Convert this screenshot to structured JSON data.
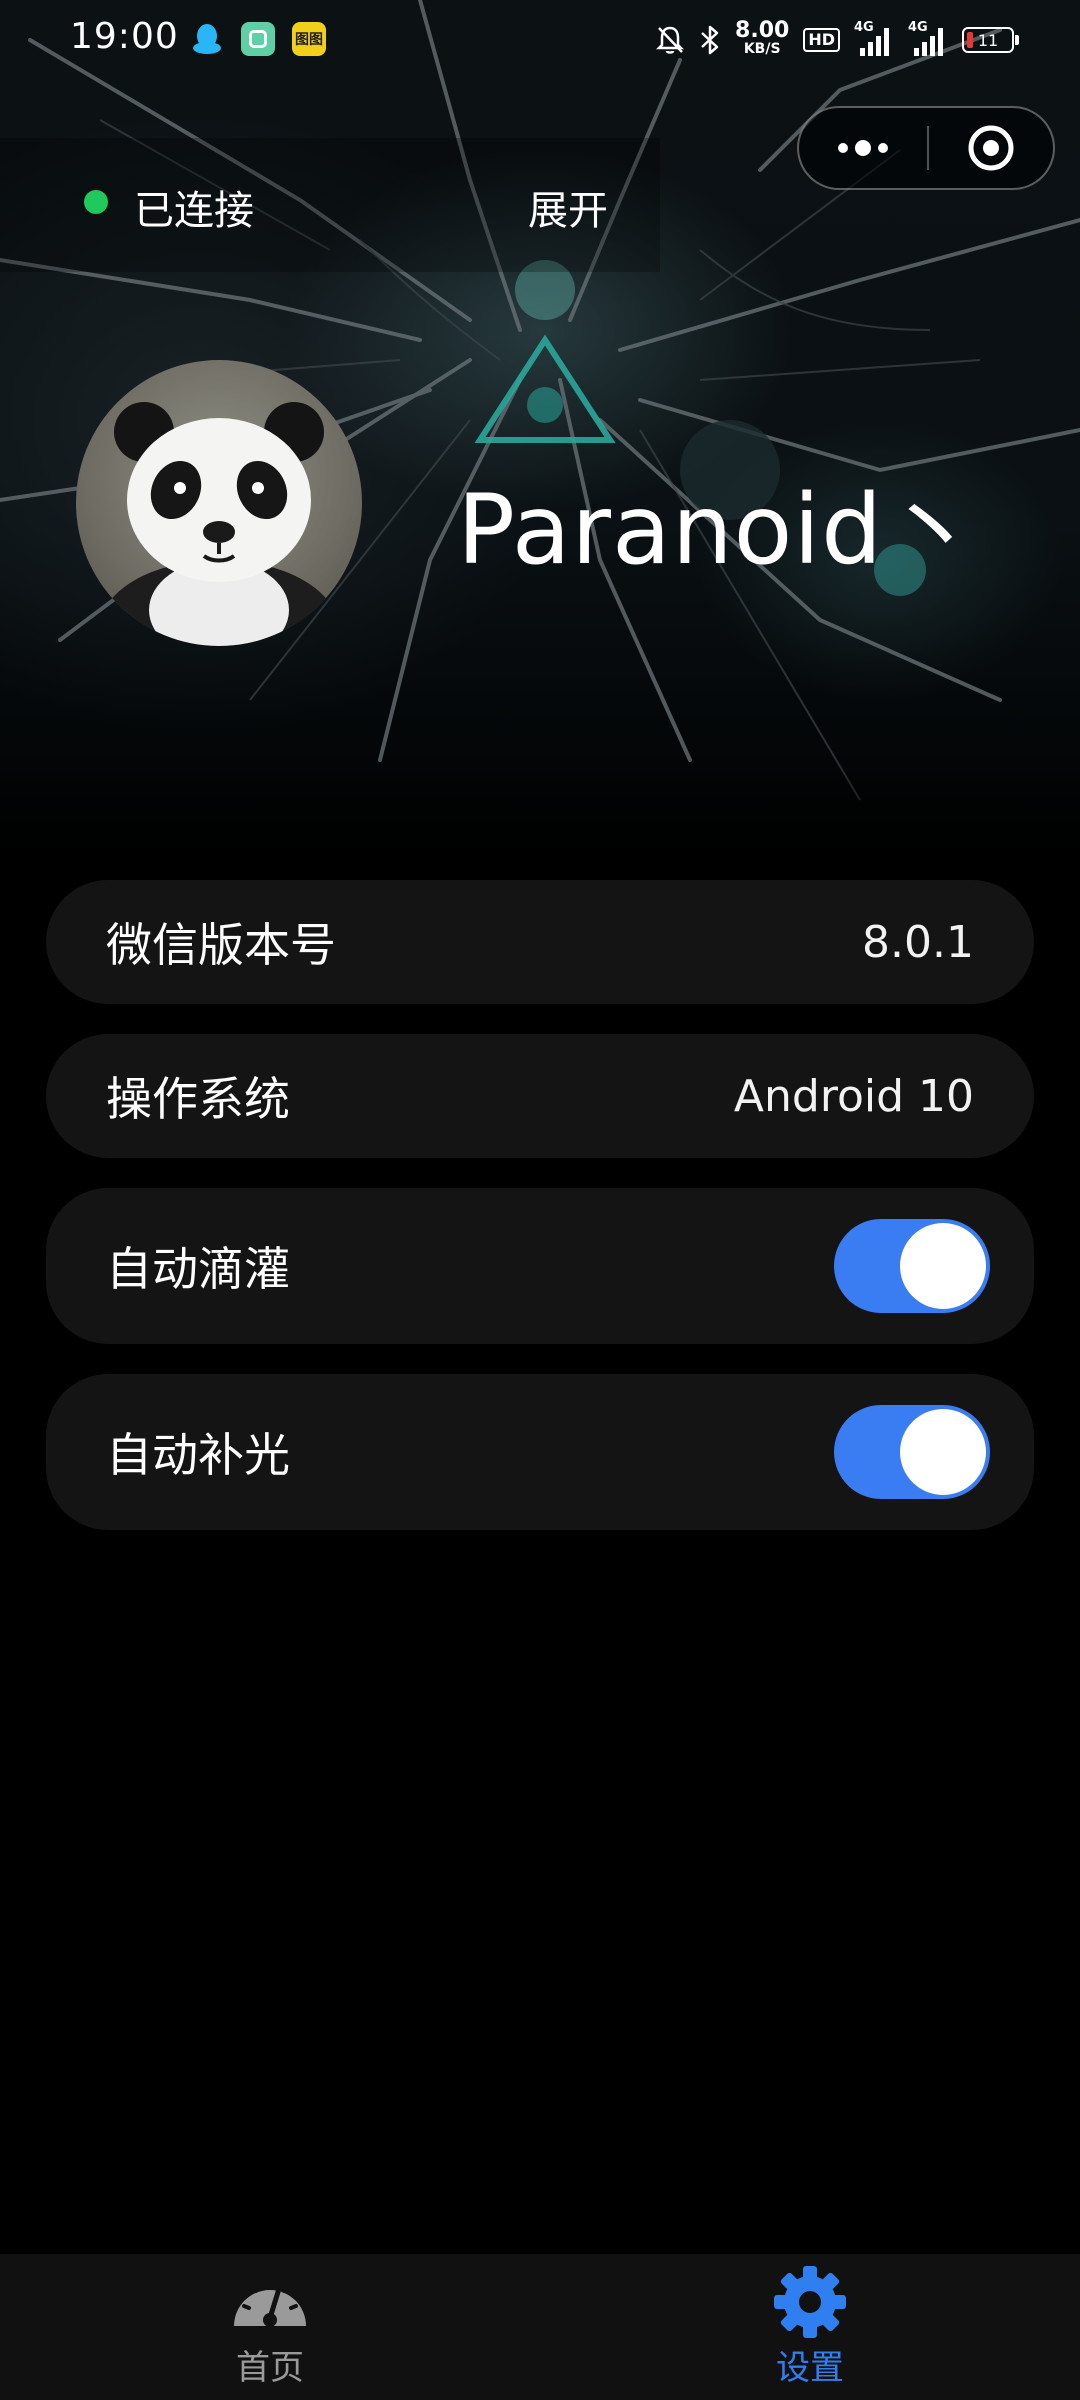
{
  "status_bar": {
    "time": "19:00",
    "net_speed_value": "8.00",
    "net_speed_unit": "KB/S",
    "hd_label": "HD",
    "signal1_label": "4G",
    "signal2_label": "4G",
    "battery_level": "11",
    "app_icon3_label": "图图",
    "icons": [
      "qq-icon",
      "wechat-mini-icon",
      "app-icon",
      "bell-muted-icon",
      "bluetooth-icon"
    ]
  },
  "header": {
    "connection_status": "已连接",
    "expand_label": "展开",
    "connected_color": "#1fc95b"
  },
  "profile": {
    "username": "Paranoid丶"
  },
  "settings": {
    "wechat_version_label": "微信版本号",
    "wechat_version_value": "8.0.1",
    "os_label": "操作系统",
    "os_value": "Android 10",
    "auto_irrigation_label": "自动滴灌",
    "auto_irrigation_on": true,
    "auto_light_label": "自动补光",
    "auto_light_on": true,
    "toggle_color": "#3a7df2"
  },
  "tab_bar": {
    "home_label": "首页",
    "settings_label": "设置",
    "active_tab": "settings",
    "active_color": "#2f7ff0",
    "inactive_color": "#9a9a9a"
  }
}
